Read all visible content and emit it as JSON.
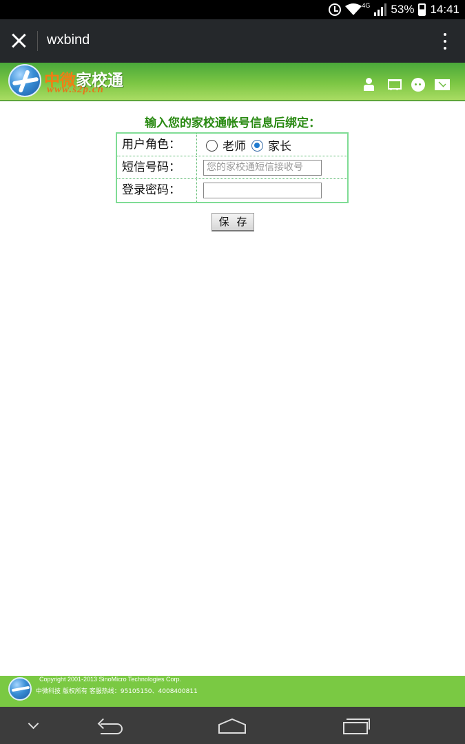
{
  "status_bar": {
    "network": "4G",
    "battery": "53%",
    "time": "14:41"
  },
  "toolbar": {
    "title": "wxbind"
  },
  "site_header": {
    "logo_accent": "中微",
    "logo_name": "家校通",
    "logo_url": "www.s2p.cn",
    "icons": [
      "user-icon",
      "cart-icon",
      "face-icon",
      "mail-icon"
    ]
  },
  "form": {
    "heading": "输入您的家校通帐号信息后绑定：",
    "role_label": "用户角色：",
    "role_options": [
      {
        "label": "老师",
        "checked": false
      },
      {
        "label": "家长",
        "checked": true
      }
    ],
    "phone_label": "短信号码：",
    "phone_placeholder": "您的家校通短信接收号",
    "phone_value": "",
    "password_label": "登录密码：",
    "password_value": "",
    "save_label": "保 存"
  },
  "footer": {
    "copyright": "Copyright 2001-2013 SinoMicro Technologies Corp.",
    "company_line": "中微科技 版权所有 客服热线：95105150、4008400811"
  },
  "colors": {
    "header_green": "#7cc644",
    "heading_green": "#2a8a13",
    "table_border": "#7fdc95",
    "footer_green": "#7ac943",
    "logo_orange": "#f27d14"
  }
}
